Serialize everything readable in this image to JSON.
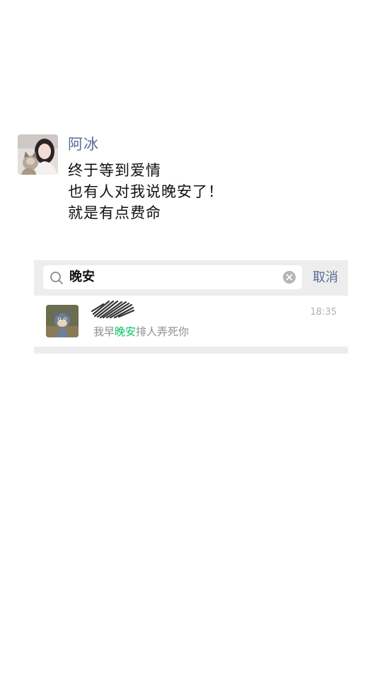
{
  "post": {
    "author": "阿冰",
    "lines": [
      "终于等到爱情",
      "也有人对我说晚安了！",
      "就是有点费命"
    ]
  },
  "search": {
    "query": "晚安",
    "cancel_label": "取消"
  },
  "result": {
    "time": "18:35",
    "snippet_before": "我早",
    "snippet_highlight": "晚安",
    "snippet_after": "排人弄死你"
  },
  "colors": {
    "link_blue": "#576b95",
    "highlight_green": "#07c160",
    "search_bar_bg": "#ededed"
  },
  "icons": {
    "search": "search-icon",
    "clear": "clear-icon"
  }
}
